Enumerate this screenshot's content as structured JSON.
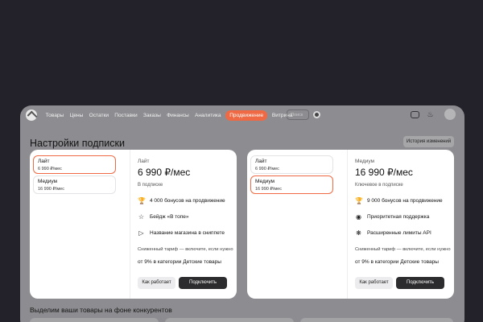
{
  "nav": {
    "items": [
      "Товары",
      "Цены",
      "Остатки",
      "Поставки",
      "Заказы",
      "Финансы",
      "Аналитика",
      "Продвижение",
      "Витрина"
    ],
    "active": "Продвижение",
    "search_placeholder": "Поиск",
    "accent_color": "#ef6a44"
  },
  "page": {
    "title": "Настройки подписки",
    "history_button": "История изменений",
    "section_title": "Выделим ваши товары на фоне конкурентов"
  },
  "cards": [
    {
      "plans": [
        {
          "name": "Лайт",
          "price": "6 990 ₽/мес",
          "selected": true
        },
        {
          "name": "Медиум",
          "price": "16 990 ₽/мес",
          "selected": false
        }
      ],
      "detail": {
        "name": "Лайт",
        "price": "6 990 ₽/мес",
        "subtitle": "В подписке",
        "features": [
          {
            "icon": "trophy-icon",
            "text": "4 000 бонусов на продвижение"
          },
          {
            "icon": "star-icon",
            "text": "Бейдж «В топе»"
          },
          {
            "icon": "tag-icon",
            "text": "Название магазина в сниппете"
          }
        ],
        "note": "Сниженный тариф — включите, если нужно",
        "note2": "от 9% в категории Детские товары",
        "how_button": "Как работает",
        "connect_button": "Подключить"
      }
    },
    {
      "plans": [
        {
          "name": "Лайт",
          "price": "6 990 ₽/мес",
          "selected": false
        },
        {
          "name": "Медиум",
          "price": "16 990 ₽/мес",
          "selected": true
        }
      ],
      "detail": {
        "name": "Медиум",
        "price": "16 990 ₽/мес",
        "subtitle": "Ключевое в подписке",
        "features": [
          {
            "icon": "trophy-icon",
            "text": "9 000 бонусов на продвижение"
          },
          {
            "icon": "headset-icon",
            "text": "Приоритетная поддержка"
          },
          {
            "icon": "api-icon",
            "text": "Расширенные лимиты API"
          }
        ],
        "note": "Сниженный тариф — включите, если нужно",
        "note2": "от 9% в категории Детские товары",
        "how_button": "Как работает",
        "connect_button": "Подключить"
      }
    }
  ]
}
